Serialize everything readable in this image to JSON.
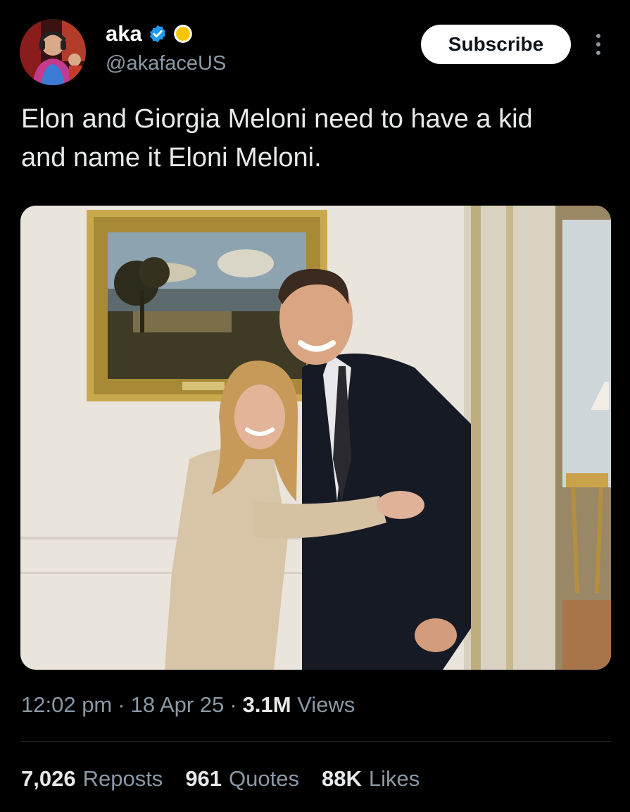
{
  "author": {
    "display_name": "aka",
    "handle": "@akafaceUS",
    "verified_color": "#1d9bf0",
    "badge_color": "#f7c600"
  },
  "header": {
    "subscribe_label": "Subscribe"
  },
  "tweet": {
    "text": "Elon and Giorgia Meloni need to have a kid\nand name it Eloni Meloni."
  },
  "meta": {
    "time": "12:02 pm",
    "sep1": "·",
    "date": "18 Apr 25",
    "sep2": "·",
    "views_count": "3.1M",
    "views_label": "Views"
  },
  "stats": {
    "reposts_count": "7,026",
    "reposts_label": "Reposts",
    "quotes_count": "961",
    "quotes_label": "Quotes",
    "likes_count": "88K",
    "likes_label": "Likes"
  }
}
